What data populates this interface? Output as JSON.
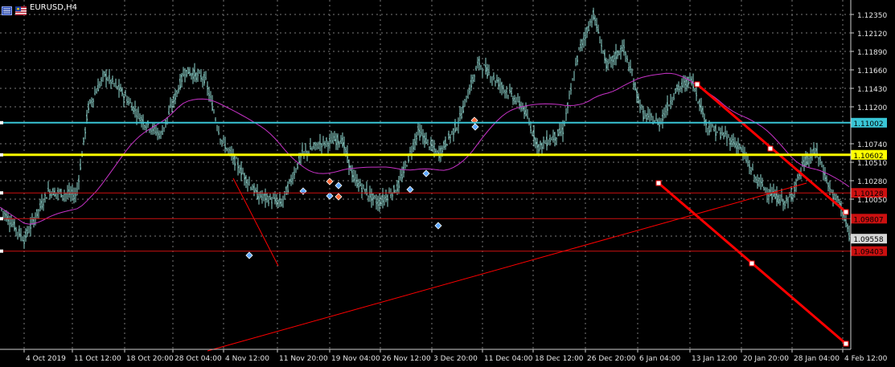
{
  "window": {
    "symbol_title": "EURUSD,H4",
    "menu_icon": "chart-menu-icon",
    "flag_icon": "eurusd-flag-icon"
  },
  "colors": {
    "background": "#000000",
    "candles": "#8fd7d0",
    "grid": "#7a7a7a",
    "moving_average": "#c832c8",
    "trend_channel": "#ff0000",
    "cyan_level": "#39c6d6",
    "yellow_level": "#ffff00",
    "red_level": "#cc1010",
    "current_price_box": "#d7d7d7"
  },
  "price_axis": {
    "ticks": [
      "1.12350",
      "1.12120",
      "1.11890",
      "1.11660",
      "1.11430",
      "1.11200",
      "1.10740",
      "1.10510",
      "1.10280",
      "1.10050",
      "1.09590"
    ]
  },
  "time_axis": {
    "labels": [
      "4 Oct 2019",
      "11 Oct 12:00",
      "18 Oct 20:00",
      "28 Oct 04:00",
      "4 Nov 12:00",
      "11 Nov 20:00",
      "19 Nov 04:00",
      "26 Nov 12:00",
      "3 Dec 20:00",
      "11 Dec 04:00",
      "18 Dec 12:00",
      "26 Dec 20:00",
      "6 Jan 04:00",
      "13 Jan 12:00",
      "20 Jan 20:00",
      "28 Jan 04:00",
      "4 Feb 12:00"
    ]
  },
  "levels": [
    {
      "name": "cyan-level",
      "price": 1.11002,
      "label": "1.11002",
      "color": "#39c6d6"
    },
    {
      "name": "yellow-level",
      "price": 1.10602,
      "label": "1.10602",
      "color": "#ffff00"
    },
    {
      "name": "red-level-upper",
      "price": 1.10128,
      "label": "1.10128",
      "color": "#cc1010"
    },
    {
      "name": "red-level-middle",
      "price": 1.09807,
      "label": "1.09807",
      "color": "#cc1010"
    },
    {
      "name": "red-level-lower",
      "price": 1.09403,
      "label": "1.09403",
      "color": "#cc1010"
    }
  ],
  "current_price": {
    "label": "1.09558",
    "price": 1.09558
  }
}
